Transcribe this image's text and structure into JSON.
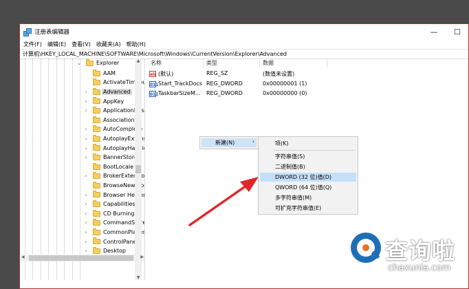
{
  "window": {
    "title": "注册表编辑器",
    "controls": {
      "minimize": "—",
      "maximize": "☐"
    }
  },
  "menu": [
    "文件(F)",
    "编辑(E)",
    "查看(V)",
    "收藏夹(A)",
    "帮助(H)"
  ],
  "address": "计算机\\HKEY_LOCAL_MACHINE\\SOFTWARE\\Microsoft\\Windows\\CurrentVersion\\Explorer\\Advanced",
  "tree": {
    "parent": "Explorer",
    "items": [
      {
        "label": "AAM",
        "expandable": false
      },
      {
        "label": "ActivateTimeout",
        "expandable": false
      },
      {
        "label": "Advanced",
        "expandable": true,
        "selected": true
      },
      {
        "label": "AppKey",
        "expandable": true
      },
      {
        "label": "ApplicationDest",
        "expandable": true
      },
      {
        "label": "Associations",
        "expandable": false
      },
      {
        "label": "AutoComplete",
        "expandable": true
      },
      {
        "label": "AutoplayExtensi",
        "expandable": true
      },
      {
        "label": "AutoplayHandle",
        "expandable": true
      },
      {
        "label": "BannerStore",
        "expandable": true
      },
      {
        "label": "BootLocale",
        "expandable": false
      },
      {
        "label": "BrokerExtension",
        "expandable": true
      },
      {
        "label": "BrowseNewProc",
        "expandable": false
      },
      {
        "label": "Browser Helper",
        "expandable": true
      },
      {
        "label": "Capabilities",
        "expandable": true
      },
      {
        "label": "CD Burning",
        "expandable": true
      },
      {
        "label": "CommandStore",
        "expandable": true
      },
      {
        "label": "CommonPlaces",
        "expandable": true
      },
      {
        "label": "ControlPanel",
        "expandable": true
      },
      {
        "label": "Desktop",
        "expandable": true
      }
    ]
  },
  "columns": {
    "name": "名称",
    "type": "类型",
    "data": "数据"
  },
  "values": [
    {
      "icon": "ab",
      "name": "(默认)",
      "type": "REG_SZ",
      "data": "(数值未设置)"
    },
    {
      "icon": "011",
      "name": "Start_TrackDocs",
      "type": "REG_DWORD",
      "data": "0x00000001 (1)"
    },
    {
      "icon": "011",
      "name": "TaskbarSizeM...",
      "type": "REG_DWORD",
      "data": "0x00000000 (0)"
    }
  ],
  "context_menu": {
    "new_label": "新建(N)",
    "submenu_arrow": "›"
  },
  "submenu": {
    "items": [
      {
        "label": "项(K)"
      },
      {
        "label": "字符串值(S)"
      },
      {
        "label": "二进制值(B)"
      },
      {
        "label": "DWORD (32 位)值(D)",
        "highlighted": true
      },
      {
        "label": "QWORD (64 位)值(Q)"
      },
      {
        "label": "多字符串值(M)"
      },
      {
        "label": "可扩充字符串值(E)"
      }
    ]
  },
  "annotation": {
    "arrow_color": "#e0262b"
  },
  "watermark": {
    "cn": "查询啦",
    "en": "chaxunla.com"
  }
}
